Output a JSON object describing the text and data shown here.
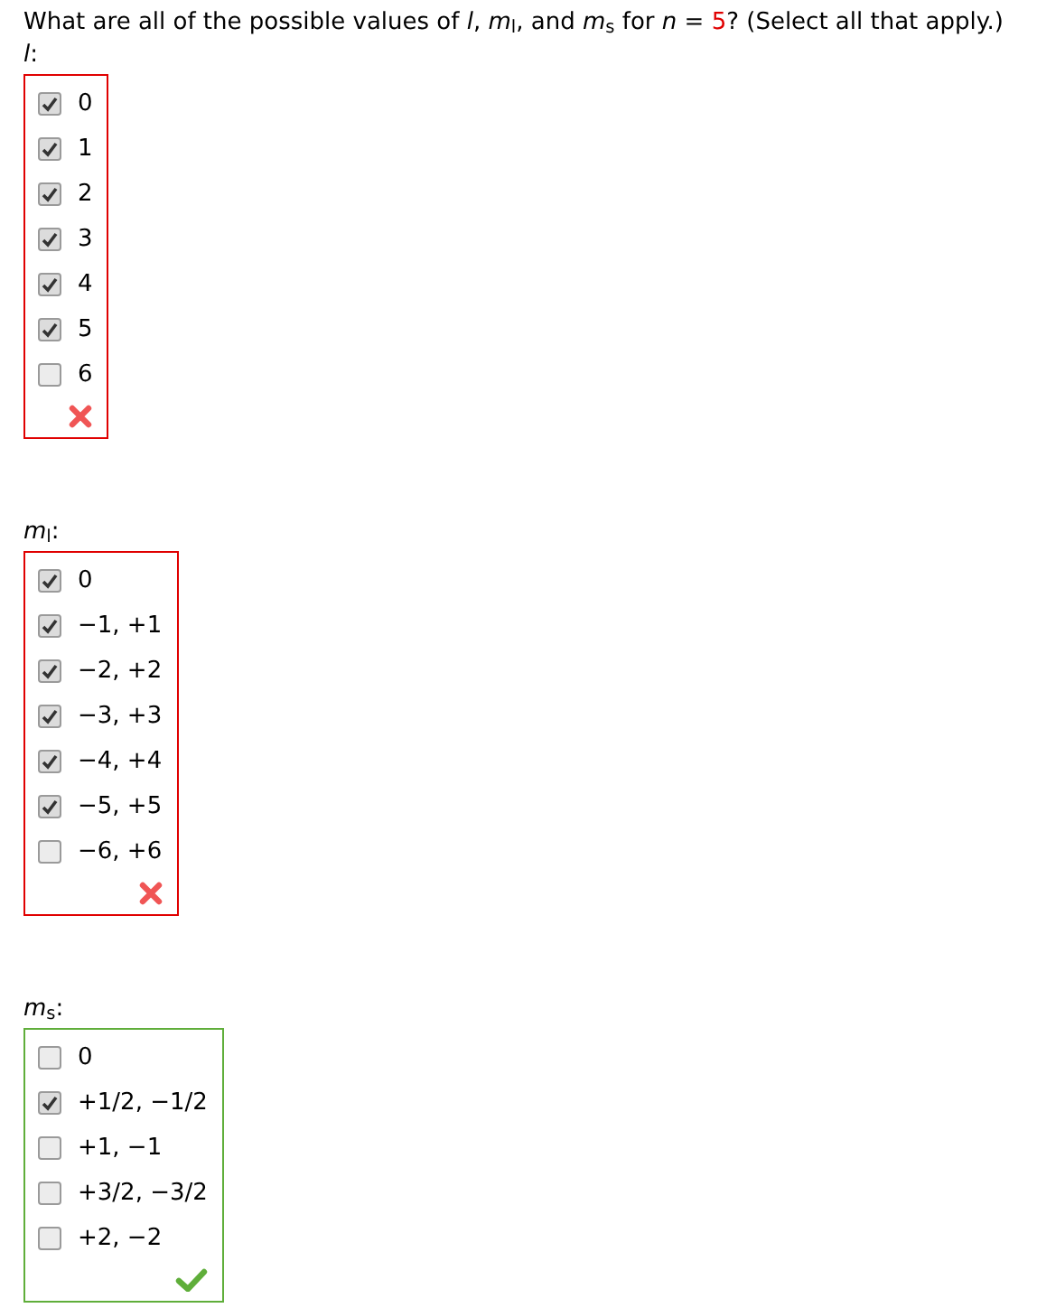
{
  "question": {
    "before": "What are all of the possible values of *l*, *m*$_{l}$, and *m*$_{s}$ for  *n* = ",
    "n_value": "5",
    "after": "?  (Select all that apply.)"
  },
  "groups": [
    {
      "label": "*l*:",
      "correct": false,
      "options": [
        {
          "text": "0",
          "checked": true
        },
        {
          "text": "1",
          "checked": true
        },
        {
          "text": "2",
          "checked": true
        },
        {
          "text": "3",
          "checked": true
        },
        {
          "text": "4",
          "checked": true
        },
        {
          "text": "5",
          "checked": true
        },
        {
          "text": "6",
          "checked": false
        }
      ]
    },
    {
      "label": "*m*$_{l}$:",
      "correct": false,
      "options": [
        {
          "text": "0",
          "checked": true
        },
        {
          "text": "−1, +1",
          "checked": true
        },
        {
          "text": "−2, +2",
          "checked": true
        },
        {
          "text": "−3, +3",
          "checked": true
        },
        {
          "text": "−4, +4",
          "checked": true
        },
        {
          "text": "−5, +5",
          "checked": true
        },
        {
          "text": "−6, +6",
          "checked": false
        }
      ]
    },
    {
      "label": "*m*$_{s}$:",
      "correct": true,
      "options": [
        {
          "text": "0",
          "checked": false
        },
        {
          "text": "+1/2, −1/2",
          "checked": true
        },
        {
          "text": "+1, −1",
          "checked": false
        },
        {
          "text": "+3/2, −3/2",
          "checked": false
        },
        {
          "text": "+2, −2",
          "checked": false
        }
      ]
    }
  ]
}
